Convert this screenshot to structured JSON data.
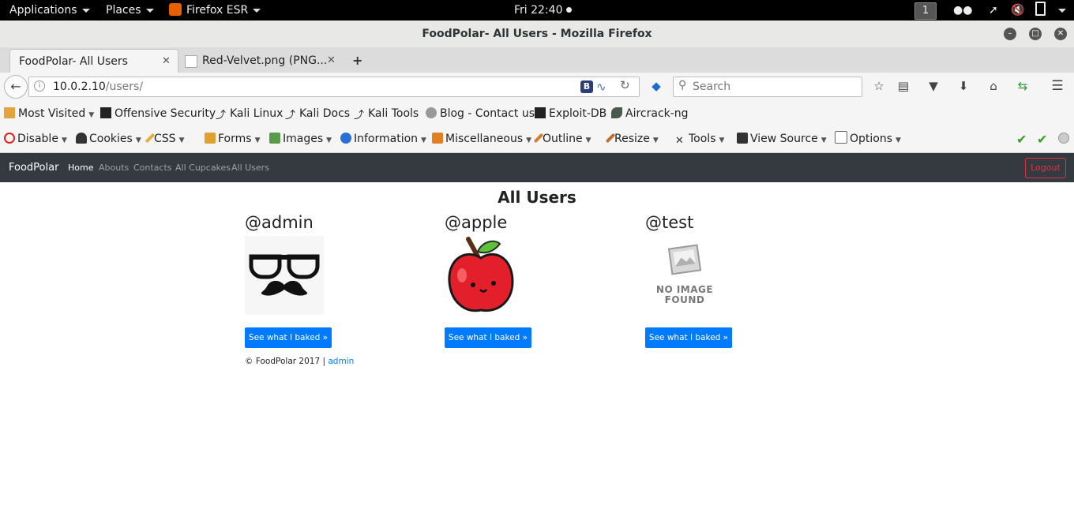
{
  "topbar": {
    "applications": "Applications",
    "places": "Places",
    "firefox": "Firefox ESR",
    "clock": "Fri 22:40",
    "workspace": "1"
  },
  "window": {
    "title": "FoodPolar- All Users - Mozilla Firefox"
  },
  "tabs": [
    {
      "label": "FoodPolar- All Users"
    },
    {
      "label": "Red-Velvet.png (PNG..."
    }
  ],
  "nav": {
    "url_host": "10.0.2.10",
    "url_path": "/users/",
    "search_placeholder": "Search"
  },
  "bookmarks": [
    {
      "label": "Most Visited"
    },
    {
      "label": "Offensive Security"
    },
    {
      "label": "Kali Linux"
    },
    {
      "label": "Kali Docs"
    },
    {
      "label": "Kali Tools"
    },
    {
      "label": "Blog - Contact us"
    },
    {
      "label": "Exploit-DB"
    },
    {
      "label": "Aircrack-ng"
    }
  ],
  "devbar": [
    {
      "label": "Disable"
    },
    {
      "label": "Cookies"
    },
    {
      "label": "CSS"
    },
    {
      "label": "Forms"
    },
    {
      "label": "Images"
    },
    {
      "label": "Information"
    },
    {
      "label": "Miscellaneous"
    },
    {
      "label": "Outline"
    },
    {
      "label": "Resize"
    },
    {
      "label": "Tools"
    },
    {
      "label": "View Source"
    },
    {
      "label": "Options"
    }
  ],
  "site": {
    "brand": "FoodPolar",
    "links": [
      "Home",
      "Abouts",
      "Contacts",
      "All Cupcakes",
      "All Users"
    ],
    "logout": "Logout",
    "heading": "All Users",
    "users": [
      {
        "handle": "@admin",
        "button": "See what I baked »"
      },
      {
        "handle": "@apple",
        "button": "See what I baked »"
      },
      {
        "handle": "@test",
        "button": "See what I baked »",
        "no_image_line1": "NO IMAGE",
        "no_image_line2": "FOUND"
      }
    ],
    "footer_text": "© FoodPolar 2017 |",
    "footer_link": "admin"
  },
  "colors": {
    "navbar_bg": "#343a40",
    "primary": "#007bff",
    "danger": "#dc3545"
  }
}
